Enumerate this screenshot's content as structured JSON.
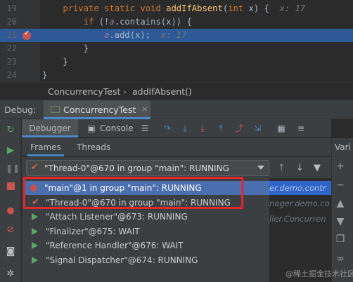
{
  "editor": {
    "lines": [
      {
        "num": "19",
        "parts": [
          {
            "t": "    "
          },
          {
            "t": "private static void ",
            "c": "kw"
          },
          {
            "t": "addIfAbsent",
            "c": "fn"
          },
          {
            "t": "("
          },
          {
            "t": "int ",
            "c": "kw"
          },
          {
            "t": "x"
          },
          {
            "t": ") {  "
          },
          {
            "t": "x: 17",
            "c": "hint"
          }
        ]
      },
      {
        "num": "20",
        "parts": [
          {
            "t": "        "
          },
          {
            "t": "if ",
            "c": "kw"
          },
          {
            "t": "(!"
          },
          {
            "t": "a",
            "c": "ital"
          },
          {
            "t": ".contains(x)) {"
          }
        ]
      },
      {
        "num": "21",
        "parts": [
          {
            "t": "            "
          },
          {
            "t": "a",
            "c": "ital"
          },
          {
            "t": ".add(x);  "
          },
          {
            "t": "x: 17",
            "c": "hint"
          }
        ]
      },
      {
        "num": "22",
        "parts": [
          {
            "t": "        }"
          }
        ]
      },
      {
        "num": "23",
        "parts": [
          {
            "t": "    }"
          }
        ]
      },
      {
        "num": "24",
        "parts": [
          {
            "t": "}"
          }
        ]
      }
    ]
  },
  "breadcrumb": {
    "class": "ConcurrencyTest",
    "method": "addIfAbsent()"
  },
  "debug": {
    "label": "Debug:",
    "tab_label": "ConcurrencyTest",
    "close_icon": "×"
  },
  "subtabs": {
    "debugger": "Debugger",
    "console": "Console"
  },
  "frames_tabs": {
    "frames": "Frames",
    "threads": "Threads"
  },
  "variables_title": "Vari",
  "thread_combo": {
    "selected": "\"Thread-0\"@670 in group \"main\": RUNNING"
  },
  "threads": [
    {
      "label": "\"main\"@1 in group \"main\": RUNNING",
      "icon": "suspended-dot-icon",
      "selected": true
    },
    {
      "label": "\"Thread-0\"@670 in group \"main\": RUNNING",
      "icon": "checkmark-icon",
      "selected": false
    },
    {
      "label": "\"Attach Listener\"@673: RUNNING",
      "icon": "running-triangle-icon",
      "selected": false
    },
    {
      "label": "\"Finalizer\"@675: WAIT",
      "icon": "running-triangle-icon",
      "selected": false
    },
    {
      "label": "\"Reference Handler\"@676: WAIT",
      "icon": "running-triangle-icon",
      "selected": false
    },
    {
      "label": "\"Signal Dispatcher\"@674: RUNNING",
      "icon": "running-triangle-icon",
      "selected": false
    }
  ],
  "stack_peek": [
    {
      "text": "er.demo.contr",
      "sel": true
    },
    {
      "text": "nager.demo.co",
      "sel": false
    },
    {
      "text": "ller.Concurren",
      "sel": false
    }
  ],
  "watermark": "@稀土掘金技术社区",
  "colors": {
    "accent": "#4a88c7",
    "selection": "#4b6eaf",
    "highlight_box": "#e3272d"
  }
}
